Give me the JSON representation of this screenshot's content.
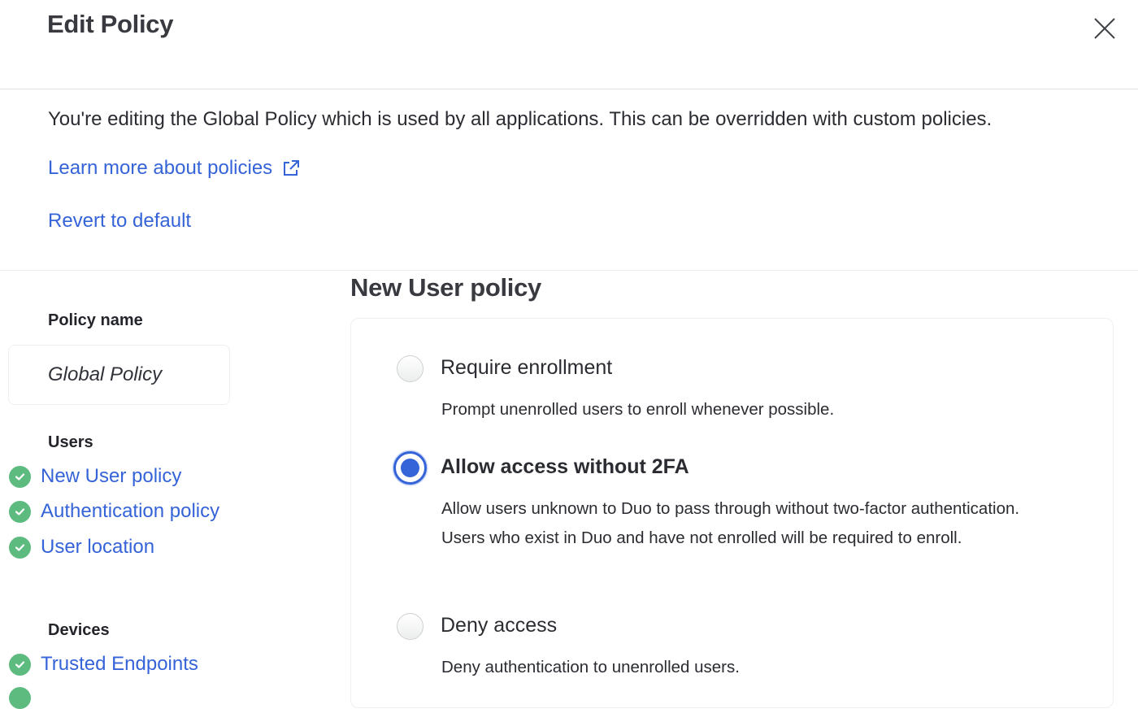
{
  "header": {
    "title": "Edit Policy",
    "close_icon": "close-icon"
  },
  "intro": {
    "text": "You're editing the Global Policy which is used by all applications. This can be overridden with custom policies.",
    "learn_more_label": "Learn more about policies",
    "learn_more_icon": "external-link-icon",
    "revert_label": "Revert to default"
  },
  "sidebar": {
    "policy_name_label": "Policy name",
    "policy_name_value": "Global Policy",
    "sections": [
      {
        "heading": "Users",
        "items": [
          {
            "label": "New User policy",
            "status": "complete"
          },
          {
            "label": "Authentication policy",
            "status": "complete"
          },
          {
            "label": "User location",
            "status": "complete"
          }
        ]
      },
      {
        "heading": "Devices",
        "items": [
          {
            "label": "Trusted Endpoints",
            "status": "complete"
          }
        ]
      }
    ]
  },
  "main": {
    "title": "New User policy",
    "selected_option": "Allow access without 2FA",
    "options": [
      {
        "label": "Require enrollment",
        "description": "Prompt unenrolled users to enroll whenever possible.",
        "selected": false
      },
      {
        "label": "Allow access without 2FA",
        "description": "Allow users unknown to Duo to pass through without two-factor authentication. Users who exist in Duo and have not enrolled will be required to enroll.",
        "selected": true
      },
      {
        "label": "Deny access",
        "description": "Deny authentication to unenrolled users.",
        "selected": false
      }
    ]
  },
  "colors": {
    "link": "#3563d8",
    "success": "#5dbb80",
    "radio_selected": "#3563d8",
    "text": "#23252b"
  }
}
